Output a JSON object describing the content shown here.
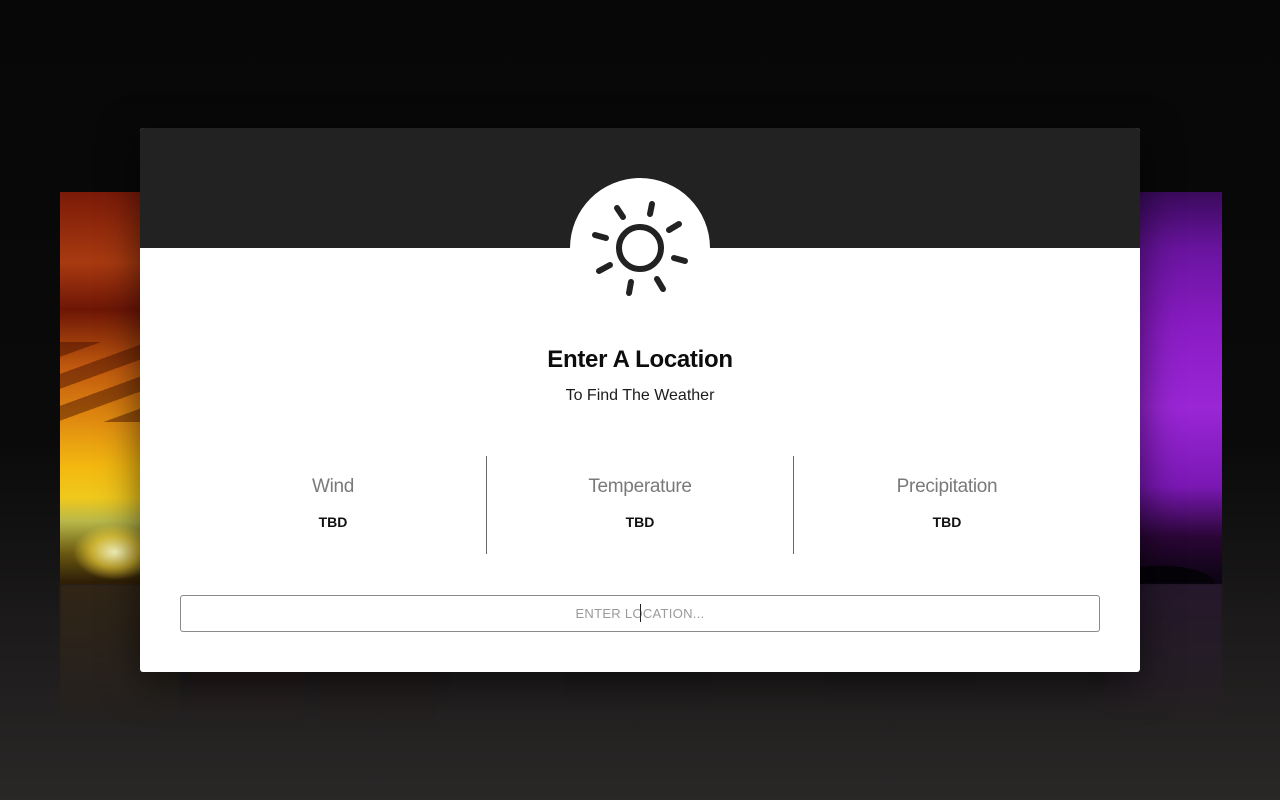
{
  "app": {
    "title": "Enter A Location",
    "subtitle": "To Find The Weather"
  },
  "header": {
    "icon": "sun-icon"
  },
  "stats": [
    {
      "label": "Wind",
      "value": "TBD"
    },
    {
      "label": "Temperature",
      "value": "TBD"
    },
    {
      "label": "Precipitation",
      "value": "TBD"
    }
  ],
  "search": {
    "placeholder": "ENTER LOCATION...",
    "value": ""
  },
  "colors": {
    "header_bg": "#222222",
    "card_bg": "#ffffff",
    "icon_color": "#222222",
    "label_color": "#7a7a7a"
  }
}
